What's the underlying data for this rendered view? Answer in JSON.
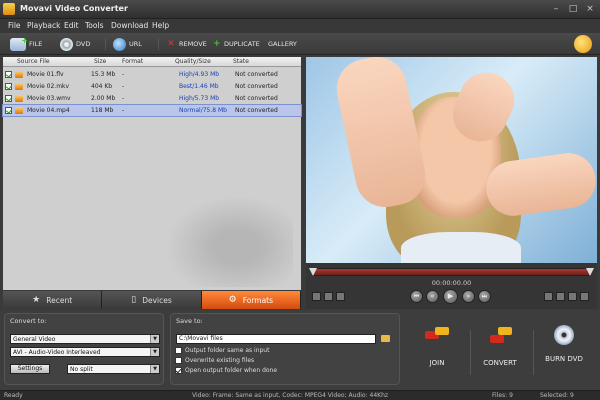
{
  "window": {
    "title": "Movavi Video Converter"
  },
  "menu": [
    "File",
    "Playback",
    "Edit",
    "Tools",
    "Download",
    "Help"
  ],
  "toolbar": {
    "file": "FILE",
    "dvd": "DVD",
    "url": "URL",
    "remove": "REMOVE",
    "duplicate": "DUPLICATE",
    "gallery": "GALLERY"
  },
  "filelist": {
    "columns": [
      "Source File",
      "Size",
      "Format",
      "Quality/Size",
      "State"
    ],
    "rows": [
      {
        "name": "Movie 01.flv",
        "size": "15.3 Mb",
        "format": "-",
        "quality": "High/4.93 Mb",
        "state": "Not converted",
        "selected": false
      },
      {
        "name": "Movie 02.mkv",
        "size": "404 Kb",
        "format": "-",
        "quality": "Best/1.46 Mb",
        "state": "Not converted",
        "selected": false
      },
      {
        "name": "Movie 03.wmv",
        "size": "2.00 Mb",
        "format": "-",
        "quality": "High/5.73 Mb",
        "state": "Not converted",
        "selected": false
      },
      {
        "name": "Movie 04.mp4",
        "size": "118 Mb",
        "format": "-",
        "quality": "Normal/75.8 Mb",
        "state": "Not converted",
        "selected": true
      }
    ]
  },
  "player": {
    "time": "00:00:00.00"
  },
  "tabs": [
    {
      "label": "Recent",
      "active": false
    },
    {
      "label": "Devices",
      "active": false
    },
    {
      "label": "Formats",
      "active": true
    }
  ],
  "convert_to": {
    "title": "Convert to:",
    "profile": "General Video",
    "format": "AVI - Audio-Video Interleaved",
    "settings_label": "Settings",
    "split": "No split"
  },
  "save_to": {
    "title": "Save to:",
    "path": "C:\\Movavi files",
    "options": [
      {
        "label": "Output folder same as input",
        "checked": false
      },
      {
        "label": "Overwrite existing files",
        "checked": false
      },
      {
        "label": "Open output folder when done",
        "checked": true
      }
    ]
  },
  "actions": {
    "join": "JOIN",
    "convert": "CONVERT",
    "burn": "BURN DVD"
  },
  "status": {
    "ready": "Ready",
    "frame_info": "Video: Frame: Same as input, Codec: MPEG4 Video; Audio: 44Khz",
    "files": "Files: 9",
    "selected": "Selected: 9"
  },
  "colors": {
    "accent": "#e8611c",
    "selection": "#b9c6ea",
    "seek": "#a83a32"
  }
}
